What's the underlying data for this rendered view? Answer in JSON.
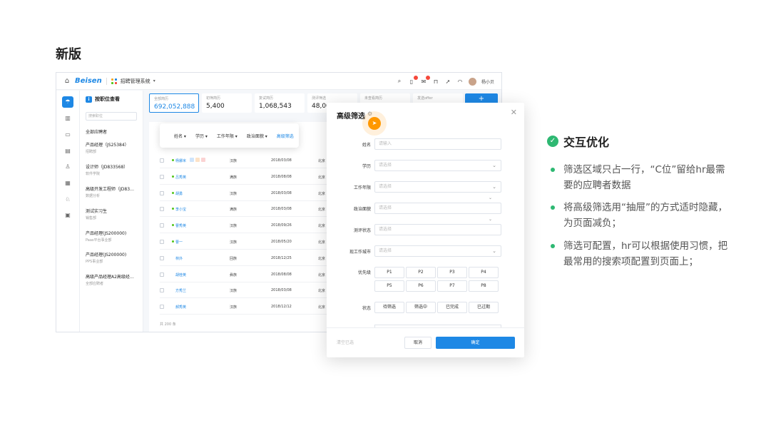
{
  "heading": "新版",
  "app": {
    "logo": "Beisen",
    "system_name": "招聘管理系统",
    "username": "杨小贝",
    "badges": {
      "bell": "2",
      "mail": "8"
    }
  },
  "job_panel": {
    "title": "按职位查看",
    "search_placeholder": "搜索职位",
    "all_label": "全部应聘者",
    "jobs": [
      {
        "title": "产品经理（JS25384）",
        "dept": "招聘部"
      },
      {
        "title": "设计师（JD833568）",
        "dept": "软件学院"
      },
      {
        "title": "高级开发工程师（JD83…",
        "dept": "数据分析"
      },
      {
        "title": "测试实习生",
        "dept": "销售部"
      },
      {
        "title": "产品经理(JS200000)",
        "dept": "Paas平台事业部"
      },
      {
        "title": "产品经理(JS200000)",
        "dept": "PPS事业部"
      },
      {
        "title": "高级产品经理A2高级经…",
        "dept": "全部应聘者"
      }
    ]
  },
  "stats": [
    {
      "label": "全部简历",
      "value": "692,052,888"
    },
    {
      "label": "初筛简历",
      "value": "5,400"
    },
    {
      "label": "复试简历",
      "value": "1,068,543"
    },
    {
      "label": "测评筛选",
      "value": "48,00"
    },
    {
      "label": "未查看简历",
      "value": ""
    },
    {
      "label": "发送offer",
      "value": ""
    }
  ],
  "filter_bar": {
    "name": "姓名",
    "edu": "学历",
    "years": "工作年限",
    "politics": "政治面貌",
    "advanced": "高级筛选"
  },
  "rows": [
    {
      "name": "杨娜米",
      "ethnic": "汉族",
      "date": "2018/03/08",
      "city": "北京"
    },
    {
      "name": "吕秀英",
      "ethnic": "满族",
      "date": "2018/08/08",
      "city": "北京"
    },
    {
      "name": "胡勇",
      "ethnic": "汉族",
      "date": "2018/03/08",
      "city": "北京"
    },
    {
      "name": "李小宝",
      "ethnic": "满族",
      "date": "2018/03/08",
      "city": "北京"
    },
    {
      "name": "曹秀英",
      "ethnic": "汉族",
      "date": "2018/09/26",
      "city": "北京"
    },
    {
      "name": "曹一",
      "ethnic": "汉族",
      "date": "2018/05/20",
      "city": "北京"
    },
    {
      "name": "林外",
      "ethnic": "回族",
      "date": "2018/12/25",
      "city": "北京"
    },
    {
      "name": "胡桂英",
      "ethnic": "彝族",
      "date": "2018/08/08",
      "city": "北京"
    },
    {
      "name": "方秀兰",
      "ethnic": "汉族",
      "date": "2018/03/08",
      "city": "北京"
    },
    {
      "name": "郝秀英",
      "ethnic": "汉族",
      "date": "2018/12/12",
      "city": "北京"
    }
  ],
  "total": "共 200 条",
  "drawer": {
    "title": "高级筛选",
    "fields": {
      "name_label": "姓名",
      "name_placeholder": "请输入",
      "edu_label": "学历",
      "years_label": "工作年限",
      "politics_label": "政治面貌",
      "eval_label": "测评状态",
      "city_label": "现工作城市",
      "select_placeholder": "请选择",
      "priority_label": "优先级",
      "status_label": "状态"
    },
    "priorities": [
      "P1",
      "P2",
      "P3",
      "P4",
      "P5",
      "P6",
      "P7",
      "P8"
    ],
    "statuses": [
      "待筛选",
      "筛选中",
      "已完成",
      "已过期"
    ],
    "clear": "清空已选",
    "cancel": "取消",
    "confirm": "确定"
  },
  "notes": {
    "title": "交互优化",
    "items": [
      "筛选区域只占一行，“C位”留给hr最需要的应聘者数据",
      "将高级筛选用“抽屉”的方式适时隐藏，为页面减负；",
      "筛选可配置，hr可以根据使用习惯，把最常用的搜索项配置到页面上；"
    ]
  },
  "colors": {
    "accent": "#1e88e5",
    "success": "#2eb872",
    "cursor": "#ff9800"
  }
}
